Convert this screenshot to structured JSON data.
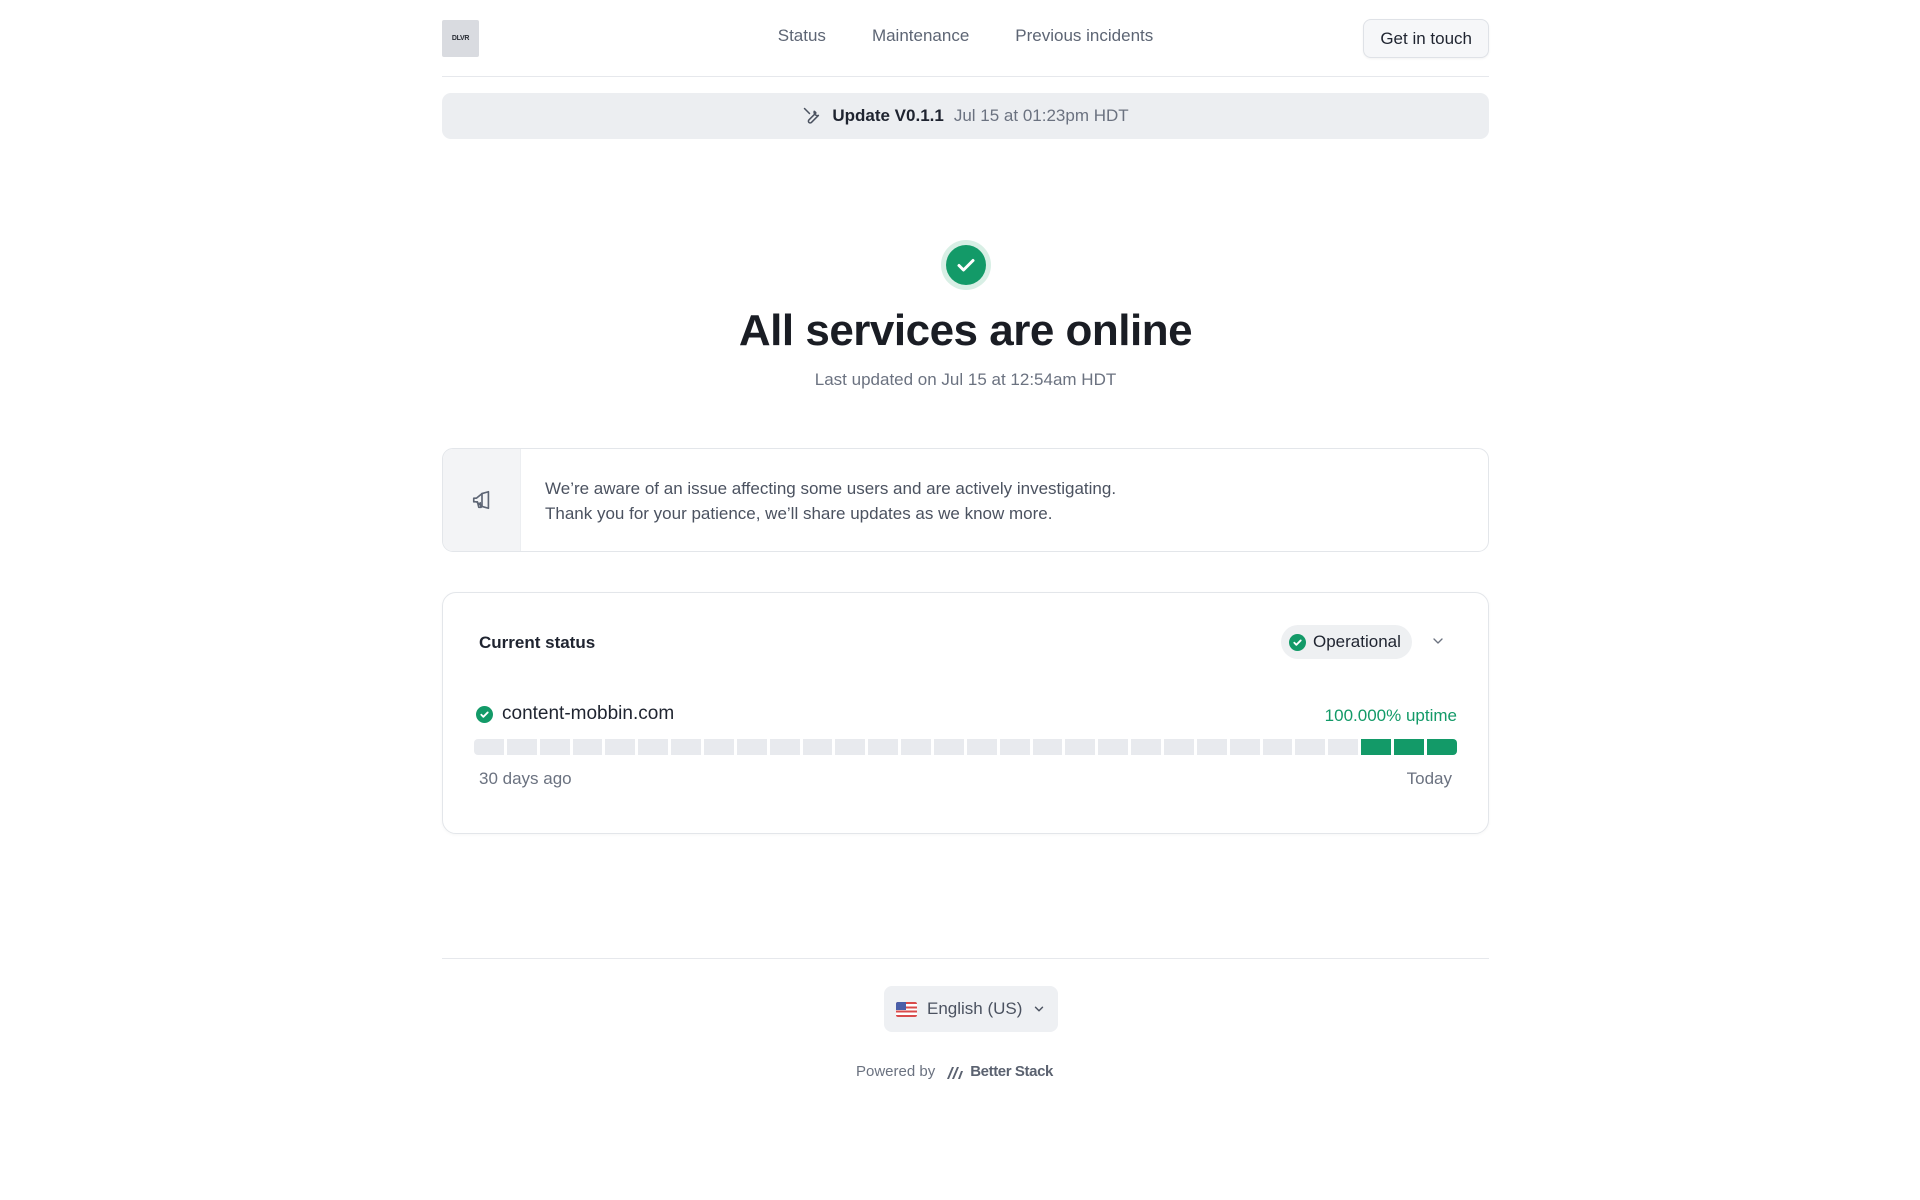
{
  "header": {
    "logo_text": "DLVR",
    "nav": [
      "Status",
      "Maintenance",
      "Previous incidents"
    ],
    "cta_label": "Get in touch"
  },
  "banner": {
    "icon": "wrench-icon",
    "title": "Update V0.1.1",
    "time": "Jul 15 at 01:23pm HDT"
  },
  "hero": {
    "icon": "check-circle-icon",
    "title": "All services are online",
    "updated": "Last updated on Jul 15 at 12:54am HDT"
  },
  "notice": {
    "icon": "megaphone-icon",
    "line1": "We’re aware of an issue affecting some users and are actively investigating.",
    "line2": "Thank you for your patience, we’ll share updates as we know more."
  },
  "status_card": {
    "label": "Current status",
    "overall": "Operational",
    "service": {
      "name": "content-mobbin.com",
      "uptime": "100.000% uptime",
      "range_start": "30 days ago",
      "range_end": "Today",
      "bar_count": 30,
      "bars_with_data": 3
    }
  },
  "footer": {
    "language": "English (US)",
    "powered_by": "Powered by",
    "brand": "Better Stack"
  },
  "colors": {
    "operational": "#139a68",
    "no_data": "#e8eaee"
  }
}
